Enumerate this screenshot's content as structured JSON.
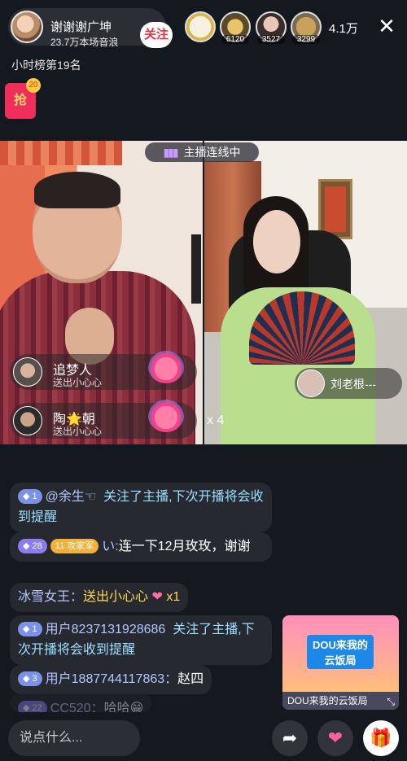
{
  "header": {
    "host_name": "谢谢谢广坤",
    "host_sub": "23.7万本场音浪",
    "follow_label": "关注",
    "viewers": [
      {
        "count": ""
      },
      {
        "count": "6120"
      },
      {
        "count": "3527"
      },
      {
        "count": "3299"
      }
    ],
    "viewer_count": "4.1万",
    "close_label": "✕"
  },
  "rank": "小时榜第19名",
  "redpacket": {
    "label": "抢",
    "badge": "20"
  },
  "video": {
    "link_status": "主播连线中",
    "combo": "x 4",
    "guest_name": "刘老根---",
    "gifts": [
      {
        "name": "追梦人",
        "desc": "送出小心心"
      },
      {
        "name": "陶🌟朝",
        "desc": "送出小心心"
      }
    ]
  },
  "chat": {
    "messages": [
      {
        "level": "1",
        "user": "@余生☜",
        "text": "关注了主播,下次开播将会收到提醒"
      },
      {
        "level": "28",
        "badge": "11 攻家军",
        "user": "い:",
        "text": "连一下12月玫玫，谢谢"
      },
      {
        "user": "冰雪女王：",
        "text": "送出小心心",
        "gift_count": "x1"
      },
      {
        "level": "1",
        "user": "用户8237131928686",
        "text": "关注了主播,下次开播将会收到提醒"
      },
      {
        "level": "3",
        "user": "用户1887744117863：",
        "text": "赵四"
      },
      {
        "level": "22",
        "user": "CC520：",
        "text": "哈哈😁"
      }
    ]
  },
  "promo": {
    "title": "DOU来我的云饭局",
    "caption": "DOU来我的云饭局",
    "expand": "⤡"
  },
  "bottom": {
    "input_placeholder": "说点什么...",
    "share_icon": "➦",
    "like_icon": "❤",
    "gift_icon": "🎁"
  }
}
